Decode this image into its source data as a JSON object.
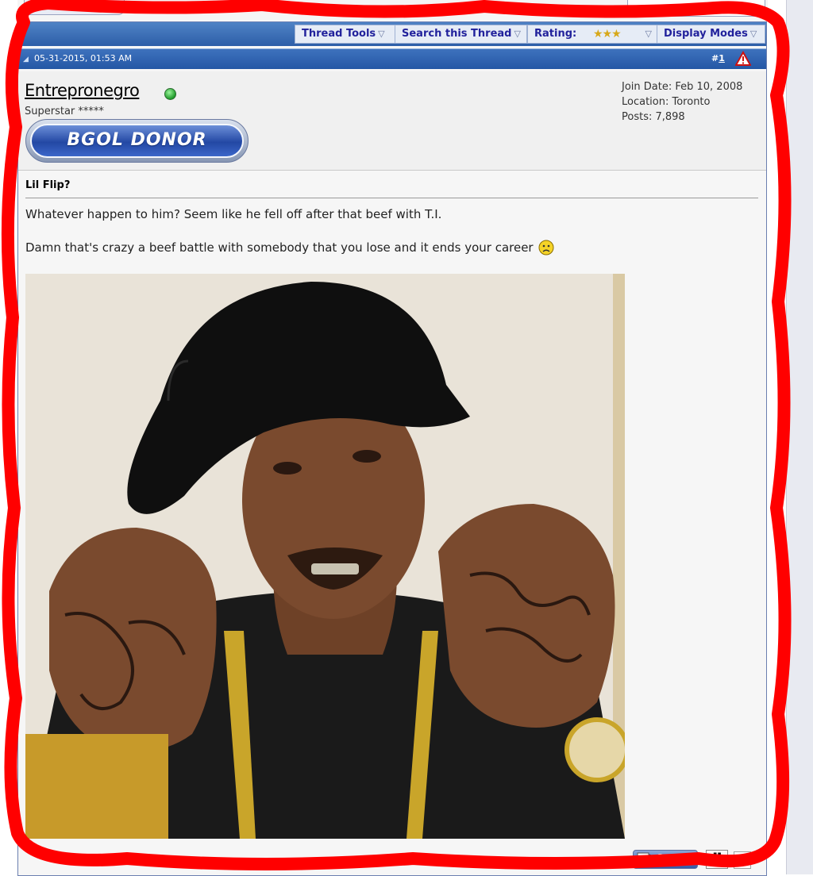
{
  "toolbar": {
    "thread_tools": "Thread Tools",
    "search_thread": "Search this Thread",
    "rating_label": "Rating:",
    "rating_stars": 3,
    "display_modes": "Display Modes"
  },
  "post": {
    "date": "05-31-2015, 01:53 AM",
    "number_prefix": "#",
    "number": "1",
    "title": "Lil Flip?",
    "body_line1": "Whatever happen to him? Seem like he fell off after that beef with T.I.",
    "body_line2": "Damn that's crazy a beef battle with somebody that you lose and it ends your career"
  },
  "user": {
    "name": "Entrepronegro",
    "title": "Superstar *****",
    "badge": "BGOL DONOR",
    "join_date": "Join Date: Feb 10, 2008",
    "location": "Location: Toronto",
    "posts": "Posts: 7,898"
  },
  "actions": {
    "quote": "Quote",
    "multiquote": "”"
  },
  "colors": {
    "toolbar_blue": "#2d5ea8",
    "link_blue": "#22229c",
    "annotation_red": "#ff0000"
  }
}
